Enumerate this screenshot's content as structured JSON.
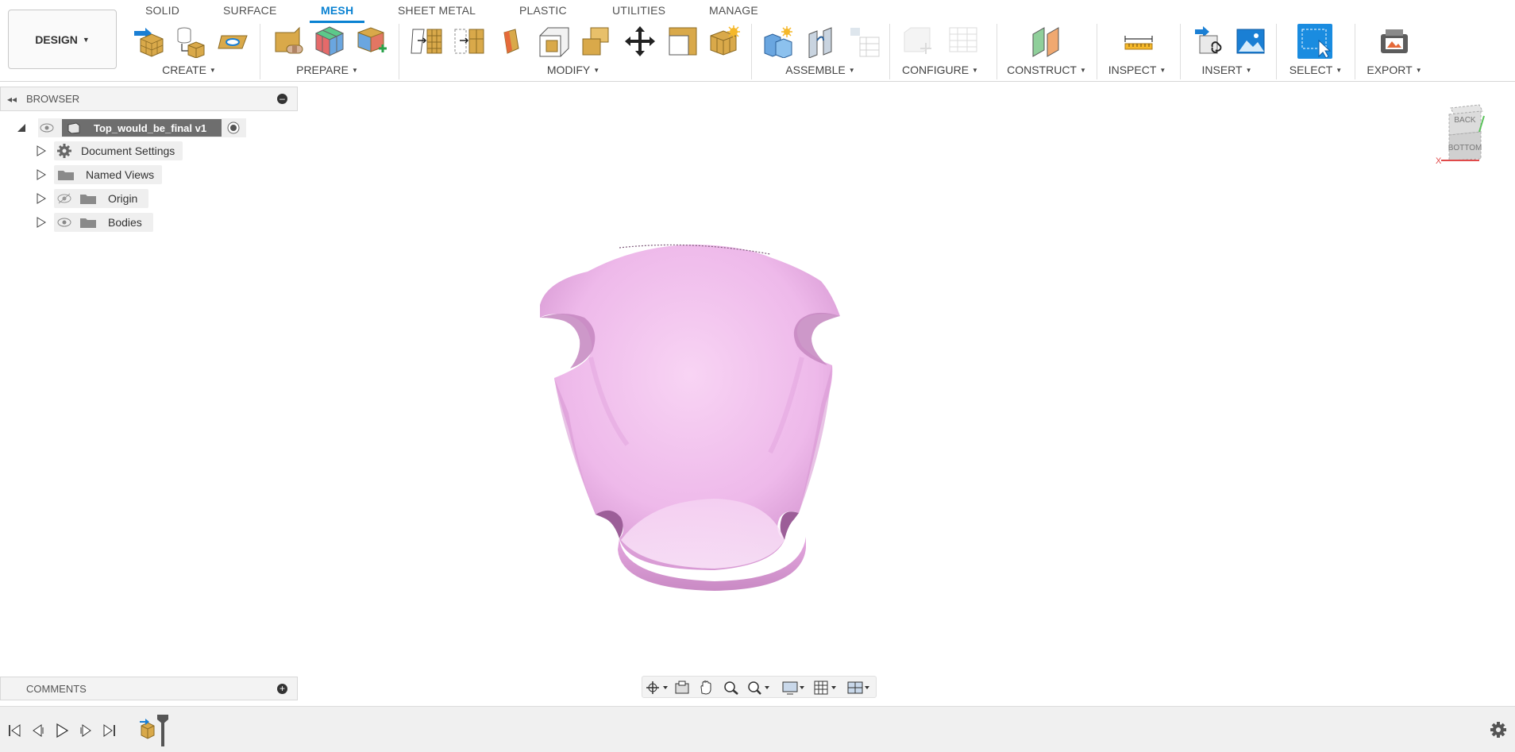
{
  "workspace": {
    "label": "DESIGN"
  },
  "tabs": [
    "SOLID",
    "SURFACE",
    "MESH",
    "SHEET METAL",
    "PLASTIC",
    "UTILITIES",
    "MANAGE"
  ],
  "active_tab": "MESH",
  "groups": {
    "create": "CREATE",
    "prepare": "PREPARE",
    "modify": "MODIFY",
    "assemble": "ASSEMBLE",
    "configure": "CONFIGURE",
    "construct": "CONSTRUCT",
    "inspect": "INSPECT",
    "insert": "INSERT",
    "select": "SELECT",
    "export": "EXPORT"
  },
  "browser": {
    "title": "BROWSER",
    "root": "Top_would_be_final v1",
    "items": [
      "Document Settings",
      "Named Views",
      "Origin",
      "Bodies"
    ]
  },
  "comments": {
    "title": "COMMENTS"
  },
  "viewcube": {
    "top_face": "BACK",
    "front_face": "BOTTOM",
    "axis_x": "X"
  },
  "colors": {
    "accent": "#0a82d2",
    "model_fill": "#efb8ec",
    "tool_gold": "#d9a94a"
  },
  "icons": {
    "tool": [
      "insert-mesh-icon",
      "tessellate-icon",
      "create-face-group-icon",
      "repair-icon",
      "remesh-icon",
      "plane-cut-icon",
      "move-icon",
      "select-box-icon"
    ],
    "nav": [
      "orbit-icon",
      "look-at-icon",
      "pan-icon",
      "zoom-icon",
      "fit-icon",
      "display-settings-icon",
      "grid-icon",
      "viewports-icon"
    ],
    "timeline": [
      "first-icon",
      "previous-icon",
      "play-icon",
      "next-icon",
      "last-icon",
      "settings-gear-icon"
    ]
  }
}
